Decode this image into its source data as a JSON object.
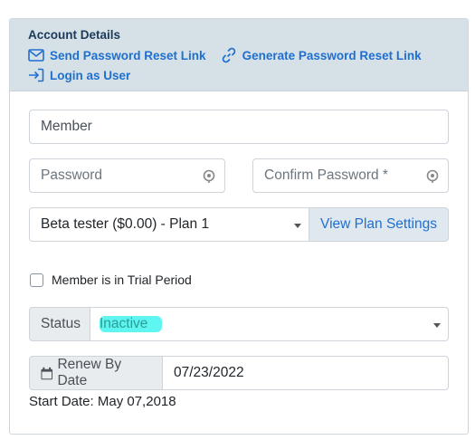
{
  "header": {
    "title": "Account Details",
    "send_reset_label": "Send Password Reset Link",
    "generate_reset_label": "Generate Password Reset Link",
    "login_as_user_label": "Login as User"
  },
  "form": {
    "member_value": "Member",
    "password_placeholder": "Password",
    "confirm_password_placeholder": "Confirm Password *",
    "plan_selected": "Beta tester ($0.00) - Plan 1",
    "view_plan_settings_label": "View Plan Settings",
    "trial_label": "Member is in Trial Period",
    "status_label": "Status",
    "status_value": "Inactive",
    "renew_label": "Renew By Date",
    "renew_value": "07/23/2022",
    "start_date": "Start Date: May 07,2018"
  },
  "colors": {
    "link": "#1f6fd0",
    "header_bg": "#d6e1e7",
    "status_highlight": "#5ff5f0"
  }
}
